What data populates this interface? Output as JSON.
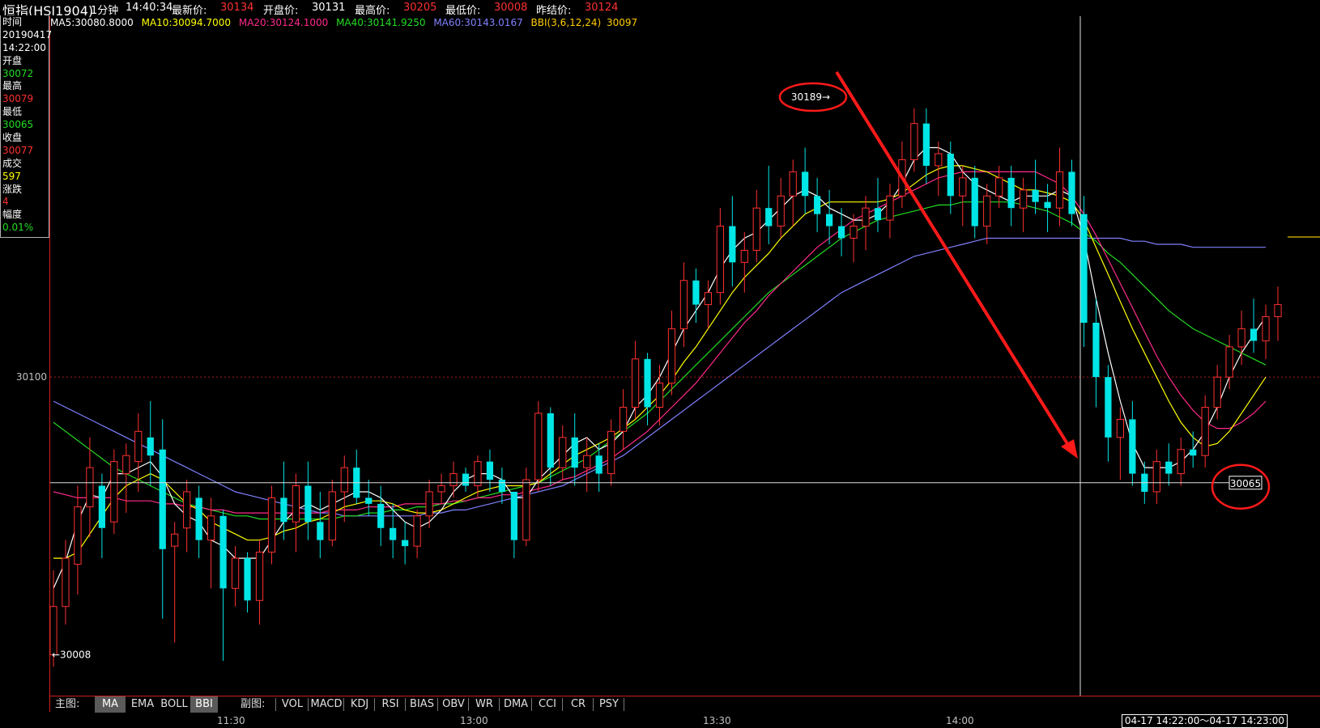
{
  "header": {
    "title": "恒指(HSI1904)",
    "period": "1分钟",
    "time": "14:40:34",
    "latest_label": "最新价:",
    "latest_value": "30134",
    "open_label": "开盘价:",
    "open_value": "30131",
    "high_label": "最高价:",
    "high_value": "30205",
    "low_label": "最低价:",
    "low_value": "30008",
    "prev_label": "昨结价:",
    "prev_value": "30124"
  },
  "ma_legend": [
    {
      "text": "MA5:30080.8000",
      "color": "#ffffff"
    },
    {
      "text": "MA10:30094.7000",
      "color": "#ffff00"
    },
    {
      "text": "MA20:30124.1000",
      "color": "#ff2a8a"
    },
    {
      "text": "MA40:30141.9250",
      "color": "#22dd22"
    },
    {
      "text": "MA60:30143.0167",
      "color": "#8080ff"
    },
    {
      "text": "BBI(3,6,12,24)",
      "color": "#ffcc00"
    },
    {
      "text": "30097",
      "color": "#ffcc00"
    }
  ],
  "info_panel": {
    "time_label": "时间",
    "date": "20190417",
    "time": "14:22:00",
    "open_label": "开盘",
    "open": "30072",
    "high_label": "最高",
    "high": "30079",
    "low_label": "最低",
    "low": "30065",
    "close_label": "收盘",
    "close": "30077",
    "volume_label": "成交",
    "volume": "597",
    "change_label": "涨跌",
    "change": "4",
    "amplitude_label": "幅度",
    "amplitude": "0.01%"
  },
  "colors": {
    "up": "#ff3030",
    "down": "#00e5e5",
    "ma5": "#ffffff",
    "ma10": "#ffff00",
    "ma20": "#ff2a8a",
    "ma40": "#22dd22",
    "ma60": "#8080ff",
    "annotation": "#ff1a1a"
  },
  "chart_data": {
    "type": "candlestick",
    "y_axis_tick": "30100",
    "ylim": [
      29995,
      30215
    ],
    "x_ticks": [
      "11:30",
      "13:00",
      "13:30",
      "14:00"
    ],
    "annotations": {
      "high_marker": "30189→",
      "low_marker": "←30008",
      "crosshair_price": "30065",
      "high_value": 30189,
      "low_value": 30008,
      "crosshair_value": 30065
    },
    "candles": [
      [
        30008,
        30036,
        30004,
        30024
      ],
      [
        30024,
        30046,
        30018,
        30040
      ],
      [
        30038,
        30064,
        30028,
        30057
      ],
      [
        30057,
        30080,
        30047,
        30070
      ],
      [
        30064,
        30068,
        30040,
        30050
      ],
      [
        30052,
        30076,
        30048,
        30072
      ],
      [
        30068,
        30078,
        30055,
        30074
      ],
      [
        30072,
        30088,
        30062,
        30082
      ],
      [
        30080,
        30092,
        30064,
        30074
      ],
      [
        30076,
        30086,
        30020,
        30043
      ],
      [
        30044,
        30052,
        30012,
        30048
      ],
      [
        30050,
        30066,
        30042,
        30062
      ],
      [
        30060,
        30064,
        30040,
        30046
      ],
      [
        30046,
        30060,
        30030,
        30054
      ],
      [
        30054,
        30056,
        30006,
        30030
      ],
      [
        30030,
        30044,
        30024,
        30040
      ],
      [
        30040,
        30042,
        30022,
        30026
      ],
      [
        30026,
        30046,
        30018,
        30042
      ],
      [
        30042,
        30064,
        30038,
        30060
      ],
      [
        30060,
        30072,
        30046,
        30052
      ],
      [
        30052,
        30068,
        30042,
        30064
      ],
      [
        30064,
        30072,
        30046,
        30052
      ],
      [
        30052,
        30062,
        30040,
        30046
      ],
      [
        30046,
        30066,
        30044,
        30062
      ],
      [
        30062,
        30074,
        30052,
        30070
      ],
      [
        30070,
        30076,
        30058,
        30060
      ],
      [
        30060,
        30066,
        30054,
        30058
      ],
      [
        30058,
        30064,
        30044,
        30050
      ],
      [
        30050,
        30058,
        30040,
        30046
      ],
      [
        30046,
        30052,
        30038,
        30044
      ],
      [
        30044,
        30056,
        30040,
        30054
      ],
      [
        30054,
        30066,
        30050,
        30062
      ],
      [
        30062,
        30068,
        30058,
        30064
      ],
      [
        30064,
        30072,
        30060,
        30068
      ],
      [
        30068,
        30070,
        30062,
        30064
      ],
      [
        30064,
        30074,
        30060,
        30072
      ],
      [
        30072,
        30076,
        30062,
        30066
      ],
      [
        30066,
        30070,
        30058,
        30062
      ],
      [
        30062,
        30062,
        30040,
        30046
      ],
      [
        30046,
        30070,
        30044,
        30066
      ],
      [
        30066,
        30092,
        30062,
        30088
      ],
      [
        30088,
        30090,
        30064,
        30070
      ],
      [
        30070,
        30084,
        30066,
        30080
      ],
      [
        30080,
        30088,
        30064,
        30070
      ],
      [
        30070,
        30080,
        30062,
        30074
      ],
      [
        30074,
        30078,
        30062,
        30068
      ],
      [
        30068,
        30086,
        30064,
        30082
      ],
      [
        30082,
        30096,
        30076,
        30090
      ],
      [
        30090,
        30112,
        30086,
        30106
      ],
      [
        30106,
        30108,
        30084,
        30090
      ],
      [
        30090,
        30104,
        30084,
        30098
      ],
      [
        30098,
        30122,
        30094,
        30116
      ],
      [
        30116,
        30138,
        30110,
        30132
      ],
      [
        30132,
        30136,
        30118,
        30124
      ],
      [
        30124,
        30132,
        30116,
        30128
      ],
      [
        30128,
        30156,
        30124,
        30150
      ],
      [
        30150,
        30160,
        30130,
        30138
      ],
      [
        30138,
        30148,
        30128,
        30142
      ],
      [
        30142,
        30162,
        30138,
        30156
      ],
      [
        30156,
        30170,
        30144,
        30150
      ],
      [
        30150,
        30166,
        30146,
        30160
      ],
      [
        30160,
        30172,
        30150,
        30168
      ],
      [
        30168,
        30176,
        30154,
        30160
      ],
      [
        30160,
        30166,
        30148,
        30154
      ],
      [
        30154,
        30162,
        30144,
        30150
      ],
      [
        30150,
        30156,
        30140,
        30146
      ],
      [
        30146,
        30154,
        30138,
        30150
      ],
      [
        30150,
        30160,
        30142,
        30156
      ],
      [
        30156,
        30166,
        30148,
        30152
      ],
      [
        30152,
        30164,
        30146,
        30160
      ],
      [
        30160,
        30178,
        30156,
        30172
      ],
      [
        30172,
        30189,
        30168,
        30184
      ],
      [
        30184,
        30189,
        30164,
        30170
      ],
      [
        30170,
        30178,
        30160,
        30174
      ],
      [
        30174,
        30178,
        30154,
        30160
      ],
      [
        30160,
        30170,
        30150,
        30166
      ],
      [
        30166,
        30170,
        30146,
        30150
      ],
      [
        30150,
        30164,
        30144,
        30160
      ],
      [
        30160,
        30170,
        30156,
        30166
      ],
      [
        30166,
        30170,
        30150,
        30156
      ],
      [
        30156,
        30166,
        30148,
        30162
      ],
      [
        30162,
        30172,
        30154,
        30158
      ],
      [
        30158,
        30164,
        30148,
        30156
      ],
      [
        30156,
        30176,
        30150,
        30168
      ],
      [
        30168,
        30172,
        30150,
        30154
      ],
      [
        30154,
        30160,
        30110,
        30118
      ],
      [
        30118,
        30126,
        30090,
        30100
      ],
      [
        30100,
        30104,
        30072,
        30080
      ],
      [
        30080,
        30090,
        30066,
        30086
      ],
      [
        30086,
        30092,
        30064,
        30068
      ],
      [
        30068,
        30072,
        30058,
        30062
      ],
      [
        30062,
        30076,
        30058,
        30072
      ],
      [
        30072,
        30078,
        30064,
        30068
      ],
      [
        30068,
        30080,
        30064,
        30076
      ],
      [
        30076,
        30082,
        30070,
        30074
      ],
      [
        30074,
        30094,
        30070,
        30090
      ],
      [
        30090,
        30104,
        30086,
        30100
      ],
      [
        30100,
        30114,
        30096,
        30110
      ],
      [
        30110,
        30122,
        30104,
        30116
      ],
      [
        30116,
        30126,
        30108,
        30112
      ],
      [
        30112,
        30124,
        30106,
        30120
      ],
      [
        30120,
        30130,
        30112,
        30124
      ]
    ],
    "ma5": [
      30030,
      30039,
      30052,
      30061,
      30060,
      30068,
      30068,
      30070,
      30072,
      30067,
      30058,
      30054,
      30052,
      30046,
      30044,
      30040,
      30040,
      30040,
      30046,
      30052,
      30056,
      30058,
      30056,
      30058,
      30060,
      30062,
      30062,
      30060,
      30056,
      30052,
      30050,
      30052,
      30056,
      30062,
      30066,
      30068,
      30068,
      30066,
      30060,
      30060,
      30066,
      30070,
      30074,
      30078,
      30080,
      30076,
      30078,
      30082,
      30090,
      30094,
      30100,
      30108,
      30116,
      30122,
      30128,
      30136,
      30142,
      30146,
      30148,
      30152,
      30156,
      30160,
      30162,
      30160,
      30156,
      30154,
      30152,
      30152,
      30154,
      30158,
      30164,
      30172,
      30176,
      30176,
      30174,
      30168,
      30164,
      30162,
      30160,
      30158,
      30160,
      30160,
      30160,
      30162,
      30160,
      30146,
      30126,
      30108,
      30092,
      30078,
      30070,
      30070,
      30070,
      30072,
      30076,
      30082,
      30090,
      30100,
      30108,
      30114,
      30120
    ],
    "ma10": [
      30040,
      30040,
      30042,
      30048,
      30054,
      30060,
      30064,
      30066,
      30068,
      30066,
      30062,
      30058,
      30056,
      30052,
      30050,
      30048,
      30046,
      30046,
      30047,
      30049,
      30050,
      30052,
      30053,
      30055,
      30057,
      30058,
      30059,
      30059,
      30058,
      30056,
      30055,
      30055,
      30056,
      30058,
      30060,
      30062,
      30063,
      30064,
      30064,
      30064,
      30065,
      30068,
      30071,
      30074,
      30076,
      30078,
      30080,
      30083,
      30086,
      30090,
      30094,
      30099,
      30105,
      30110,
      30116,
      30122,
      30128,
      30133,
      30137,
      30141,
      30146,
      30150,
      30154,
      30156,
      30158,
      30158,
      30158,
      30158,
      30158,
      30159,
      30161,
      30164,
      30167,
      30169,
      30170,
      30170,
      30169,
      30168,
      30166,
      30164,
      30162,
      30162,
      30161,
      30160,
      30158,
      30152,
      30143,
      30134,
      30125,
      30116,
      30108,
      30100,
      30092,
      30085,
      30080,
      30077,
      30078,
      30082,
      30088,
      30094,
      30100
    ],
    "ma20": [
      30062,
      30061,
      30060,
      30060,
      30060,
      30060,
      30059,
      30059,
      30059,
      30058,
      30058,
      30057,
      30057,
      30056,
      30056,
      30055,
      30055,
      30055,
      30055,
      30055,
      30055,
      30055,
      30055,
      30056,
      30056,
      30056,
      30057,
      30057,
      30057,
      30058,
      30058,
      30058,
      30058,
      30059,
      30059,
      30060,
      30060,
      30061,
      30061,
      30062,
      30063,
      30064,
      30066,
      30067,
      30069,
      30071,
      30073,
      30076,
      30079,
      30082,
      30086,
      30090,
      30094,
      30098,
      30103,
      30108,
      30113,
      30118,
      30122,
      30127,
      30131,
      30135,
      30139,
      30143,
      30146,
      30149,
      30152,
      30154,
      30156,
      30158,
      30160,
      30162,
      30164,
      30166,
      30167,
      30168,
      30168,
      30168,
      30168,
      30168,
      30168,
      30168,
      30166,
      30164,
      30160,
      30154,
      30147,
      30139,
      30131,
      30123,
      30115,
      30107,
      30100,
      30094,
      30089,
      30085,
      30083,
      30083,
      30085,
      30088,
      30092
    ],
    "ma40": [
      30085,
      30082,
      30079,
      30076,
      30073,
      30070,
      30068,
      30066,
      30064,
      30062,
      30060,
      30058,
      30057,
      30056,
      30055,
      30054,
      30054,
      30053,
      30053,
      30053,
      30053,
      30053,
      30053,
      30053,
      30054,
      30054,
      30055,
      30055,
      30056,
      30056,
      30057,
      30057,
      30058,
      30058,
      30059,
      30060,
      30061,
      30062,
      30063,
      30064,
      30065,
      30067,
      30069,
      30071,
      30073,
      30076,
      30079,
      30082,
      30085,
      30088,
      30092,
      30096,
      30100,
      30104,
      30108,
      30112,
      30116,
      30120,
      30124,
      30128,
      30131,
      30134,
      30137,
      30140,
      30143,
      30146,
      30148,
      30150,
      30152,
      30153,
      30154,
      30155,
      30156,
      30157,
      30157,
      30158,
      30158,
      30158,
      30158,
      30158,
      30157,
      30156,
      30155,
      30153,
      30151,
      30148,
      30145,
      30141,
      30138,
      30134,
      30130,
      30126,
      30122,
      30119,
      30116,
      30114,
      30112,
      30110,
      30108,
      30106,
      30104
    ],
    "ma60": [
      30092,
      30090,
      30088,
      30086,
      30084,
      30082,
      30080,
      30078,
      30076,
      30074,
      30072,
      30070,
      30068,
      30066,
      30064,
      30062,
      30061,
      30060,
      30059,
      30058,
      30057,
      30056,
      30055,
      30055,
      30054,
      30054,
      30054,
      30054,
      30054,
      30054,
      30054,
      30055,
      30055,
      30056,
      30056,
      30057,
      30058,
      30059,
      30060,
      30061,
      30062,
      30063,
      30064,
      30066,
      30068,
      30070,
      30072,
      30074,
      30077,
      30080,
      30083,
      30086,
      30089,
      30092,
      30095,
      30098,
      30101,
      30104,
      30107,
      30110,
      30113,
      30116,
      30119,
      30122,
      30125,
      30128,
      30130,
      30132,
      30134,
      30136,
      30138,
      30140,
      30141,
      30142,
      30143,
      30144,
      30145,
      30146,
      30146,
      30146,
      30146,
      30146,
      30146,
      30146,
      30146,
      30146,
      30146,
      30146,
      30146,
      30145,
      30145,
      30144,
      30144,
      30144,
      30143,
      30143,
      30143,
      30143,
      30143,
      30143,
      30143
    ]
  },
  "tabs": {
    "main_label": "主图:",
    "main": [
      "MA",
      "EMA",
      "BOLL",
      "BBI"
    ],
    "sub_label": "副图:",
    "sub": [
      "VOL",
      "MACD",
      "KDJ",
      "RSI",
      "BIAS",
      "OBV",
      "WR",
      "DMA",
      "CCI",
      "CR",
      "PSY"
    ]
  },
  "time_range": "04-17  14:22:00〜04-17  14:23:00"
}
